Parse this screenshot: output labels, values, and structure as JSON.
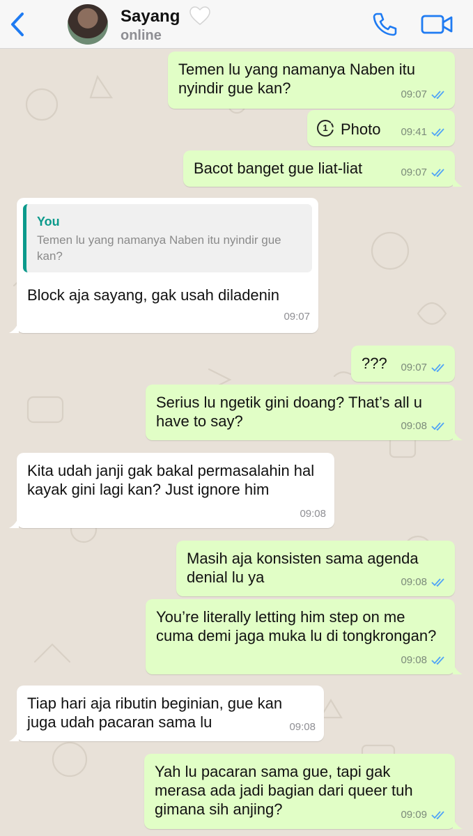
{
  "header": {
    "back_icon": "chevron-left-icon",
    "contact_name": "Sayang",
    "name_emoji": "white-heart-icon",
    "status": "online",
    "call_icon": "phone-icon",
    "video_icon": "video-camera-icon"
  },
  "colors": {
    "accent": "#1f7bf2",
    "outgoing": "#e1fec6",
    "incoming": "#ffffff",
    "quote_bar": "#0c9a8c",
    "read_ticks": "#4fa3f7"
  },
  "messages": [
    {
      "text": "Temen lu yang namanya Naben itu nyindir gue kan?",
      "time": "09:07"
    },
    {
      "text": "Photo",
      "time": "09:41",
      "view_once_count": "1"
    },
    {
      "text": "Bacot banget gue liat-liat",
      "time": "09:07"
    },
    {
      "quote_author": "You",
      "quote_text": "Temen lu yang namanya Naben itu nyindir gue kan?",
      "text": "Block aja sayang, gak usah diladenin",
      "time": "09:07"
    },
    {
      "text": "???",
      "time": "09:07"
    },
    {
      "text": "Serius lu ngetik gini doang? That’s all u have to say?",
      "time": "09:08"
    },
    {
      "text": "Kita udah janji gak bakal permasalahin hal kayak gini lagi kan? Just ignore him",
      "time": "09:08"
    },
    {
      "text": "Masih aja konsisten sama agenda denial lu ya",
      "time": "09:08"
    },
    {
      "text": "You’re literally letting him step on me cuma demi jaga muka lu di tongkrongan?",
      "time": "09:08"
    },
    {
      "text": "Tiap hari aja ributin beginian, gue kan juga udah pacaran sama lu",
      "time": "09:08"
    },
    {
      "text": "Yah lu pacaran sama gue, tapi gak merasa ada jadi bagian dari queer tuh gimana sih anjing?",
      "time": "09:09"
    }
  ]
}
